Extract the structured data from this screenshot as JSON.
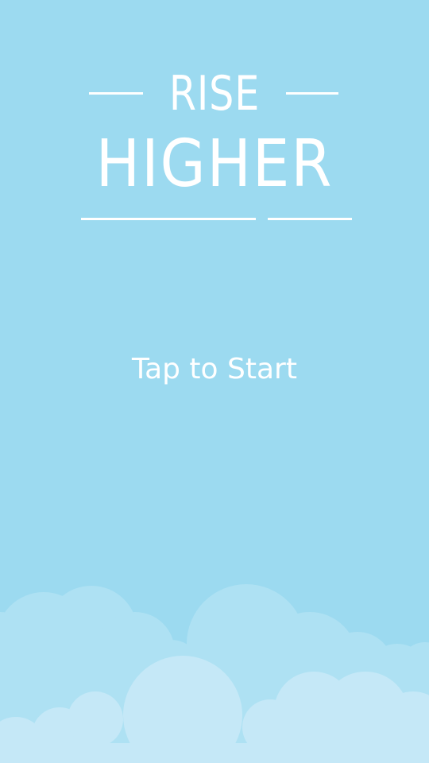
{
  "title": {
    "line1": "RISE",
    "line2": "HIGHER"
  },
  "start_prompt": "Tap to Start",
  "colors": {
    "sky": "#9cdaf0",
    "cloud_back": "#aee1f3",
    "cloud_front": "#c5e8f7",
    "text": "#ffffff"
  }
}
